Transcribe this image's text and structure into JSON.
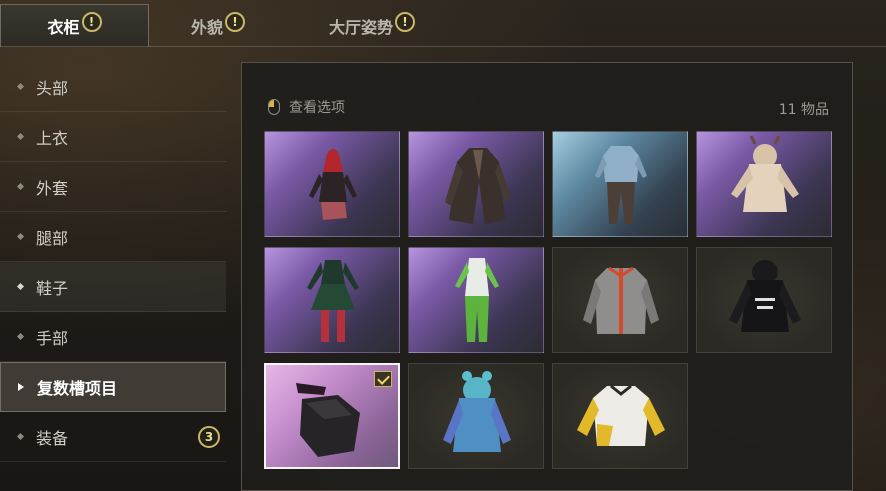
{
  "tabs": [
    {
      "label": "衣柜",
      "active": true,
      "alert": "!"
    },
    {
      "label": "外貌",
      "active": false,
      "alert": "!"
    },
    {
      "label": "大厅姿势",
      "active": false,
      "alert": "!"
    }
  ],
  "sidebar": {
    "items": [
      {
        "label": "头部"
      },
      {
        "label": "上衣"
      },
      {
        "label": "外套"
      },
      {
        "label": "腿部"
      },
      {
        "label": "鞋子",
        "state": "highlighted"
      },
      {
        "label": "手部"
      },
      {
        "label": "复数槽项目",
        "state": "active"
      },
      {
        "label": "装备",
        "badge": "3"
      }
    ]
  },
  "panel": {
    "view_options_label": "查看选项",
    "item_count": "11 物品",
    "items": [
      {
        "name": "red-hooded-outfit-item",
        "bg": "purple"
      },
      {
        "name": "leather-trench-coat-item",
        "bg": "purple"
      },
      {
        "name": "denim-shirt-outfit-item",
        "bg": "blue"
      },
      {
        "name": "reindeer-hoodie-item",
        "bg": "purple"
      },
      {
        "name": "green-dress-outfit-item",
        "bg": "purple"
      },
      {
        "name": "white-green-suit-item",
        "bg": "purple"
      },
      {
        "name": "grey-red-jacket-item",
        "bg": "dark"
      },
      {
        "name": "black-hoodie-item",
        "bg": "dark"
      },
      {
        "name": "black-face-mask-item",
        "bg": "pink",
        "equipped": true
      },
      {
        "name": "blue-ear-hoodie-item",
        "bg": "dark"
      },
      {
        "name": "yellow-white-jacket-item",
        "bg": "dark"
      }
    ]
  },
  "colors": {
    "accent_gold": "#c9b76a",
    "selected_border": "#f4f4f0"
  }
}
